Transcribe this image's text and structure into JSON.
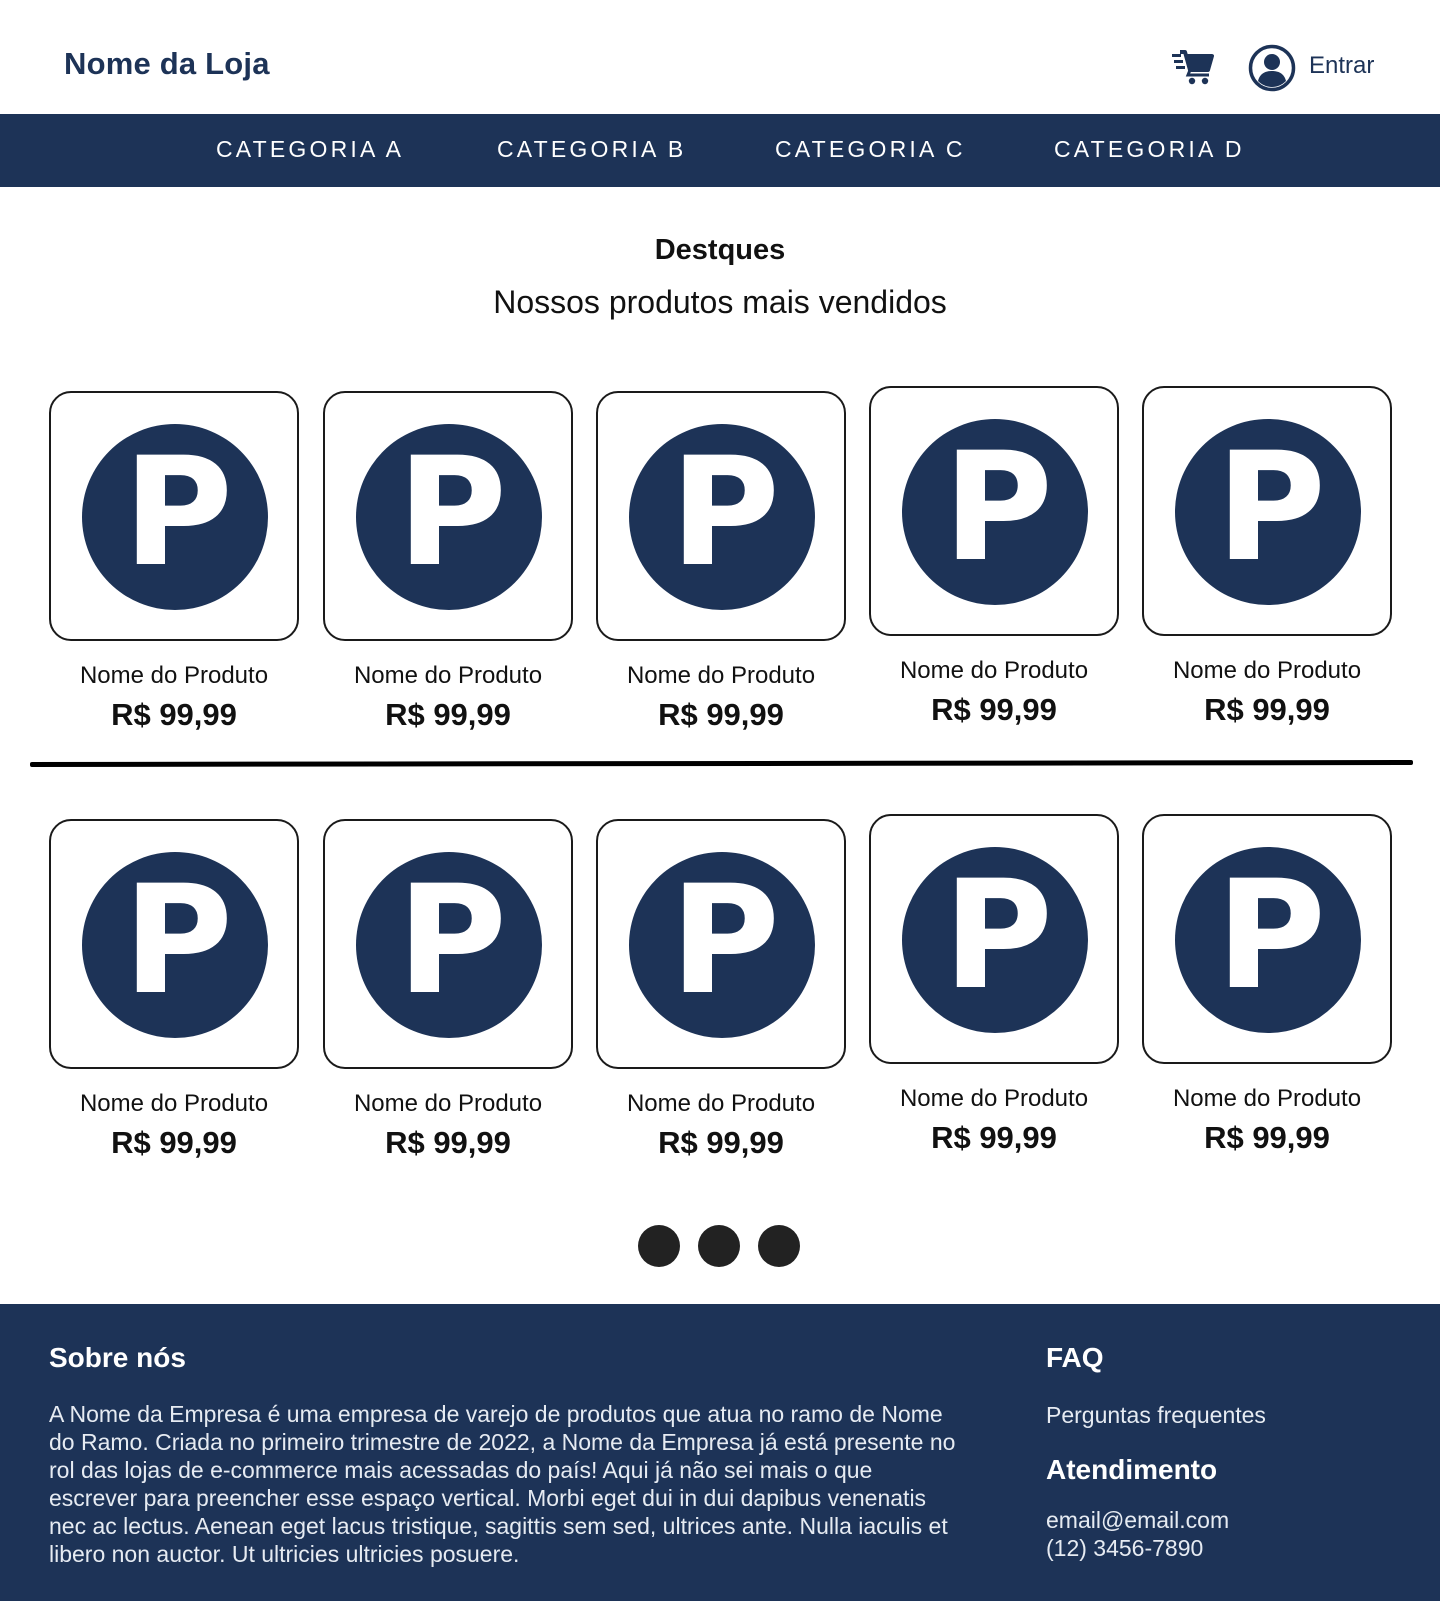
{
  "header": {
    "store_name": "Nome da Loja",
    "login_label": "Entrar"
  },
  "nav": {
    "items": [
      {
        "label": "CATEGORIA A"
      },
      {
        "label": "CATEGORIA B"
      },
      {
        "label": "CATEGORIA C"
      },
      {
        "label": "CATEGORIA D"
      }
    ]
  },
  "main": {
    "title": "Destques",
    "subtitle": "Nossos produtos mais vendidos",
    "product_icon_letter": "P",
    "products": [
      {
        "name": "Nome do Produto",
        "price": "R$ 99,99"
      },
      {
        "name": "Nome do Produto",
        "price": "R$ 99,99"
      },
      {
        "name": "Nome do Produto",
        "price": "R$ 99,99"
      },
      {
        "name": "Nome do Produto",
        "price": "R$ 99,99"
      },
      {
        "name": "Nome do Produto",
        "price": "R$ 99,99"
      },
      {
        "name": "Nome do Produto",
        "price": "R$ 99,99"
      },
      {
        "name": "Nome do Produto",
        "price": "R$ 99,99"
      },
      {
        "name": "Nome do Produto",
        "price": "R$ 99,99"
      },
      {
        "name": "Nome do Produto",
        "price": "R$ 99,99"
      },
      {
        "name": "Nome do Produto",
        "price": "R$ 99,99"
      }
    ],
    "pagination_pages": 3
  },
  "footer": {
    "about_title": "Sobre nós",
    "about_lines": [
      "A Nome da Empresa é uma empresa de varejo de produtos que atua no ramo de Nome",
      "do Ramo. Criada no primeiro trimestre de 2022, a Nome da Empresa já está presente no",
      "rol das  lojas de e-commerce mais acessadas do país! Aqui já não sei mais o que",
      "escrever para preencher esse espaço vertical. Morbi eget dui in dui dapibus venenatis",
      "nec ac lectus. Aenean eget lacus tristique, sagittis sem sed, ultrices ante. Nulla iaculis et",
      "libero non auctor. Ut ultricies ultricies posuere."
    ],
    "faq_title": "FAQ",
    "faq_link": "Perguntas frequentes",
    "support_title": "Atendimento",
    "email": "email@email.com",
    "phone": "(12) 3456-7890"
  },
  "colors": {
    "brand_navy": "#1d3357",
    "background": "#ffffff",
    "dot": "#222222"
  },
  "icons": [
    "cart-icon",
    "user-icon",
    "product-placeholder-icon"
  ]
}
